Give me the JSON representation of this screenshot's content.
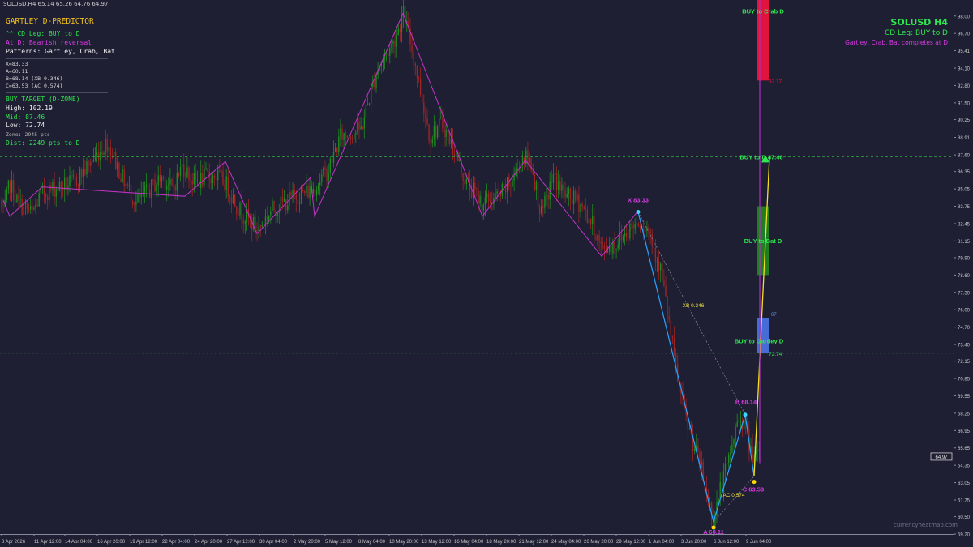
{
  "window": {
    "symbol_bar": "SOLUSD,H4  65.14 65.26 64.76 64.97"
  },
  "panel": {
    "title": "GARTLEY D-PREDICTOR",
    "cd_leg": "^^ CD Leg: BUY to D",
    "at_d": "At D: Bearish reversal",
    "patterns": "Patterns: Gartley, Crab, Bat",
    "x_line": "X=83.33",
    "a_line": "A=60.11",
    "b_line": "B=68.14  (XB 0.346)",
    "c_line": "C=63.53  (AC 0.574)",
    "buy_target_header": "BUY TARGET (D-ZONE)",
    "high_line": "High: 102.19",
    "mid_line": "Mid:  87.46",
    "low_line": "Low:  72.74",
    "zone_line": "Zone: 2945 pts",
    "dist_line": "Dist: 2249 pts to D"
  },
  "top_right": {
    "symbol": "SOLUSD H4",
    "cd_leg": "CD Leg: BUY to D",
    "completes": "Gartley, Crab, Bat completes at D"
  },
  "watermark": "currencyheatmap.com",
  "colors": {
    "background": "#1e1f33",
    "candle_up": "#1e8c1e",
    "candle_down": "#a02424",
    "zigzag": "#c633c8",
    "xabcd_leg": "#2aa4ff",
    "projection_leg": "#f5e020",
    "crab_zone": "#e0143c",
    "bat_zone": "#1f8f1f",
    "gartley_zone": "#4a70e0",
    "label_green": "#2ee84f",
    "label_magenta": "#d43be0",
    "label_yellow": "#f0e040"
  },
  "chart_data": {
    "type": "candlestick",
    "symbol": "SOLUSD",
    "timeframe": "H4",
    "ylim": [
      59.2,
      99.2
    ],
    "y_ticks": [
      "98.00",
      "96.70",
      "95.41",
      "94.10",
      "92.80",
      "91.50",
      "90.25",
      "88.91",
      "87.60",
      "86.35",
      "85.05",
      "83.75",
      "82.45",
      "81.15",
      "79.90",
      "78.60",
      "77.30",
      "76.00",
      "74.70",
      "73.40",
      "72.15",
      "70.85",
      "69.55",
      "68.25",
      "66.95",
      "65.65",
      "64.35",
      "63.05",
      "61.75",
      "60.50",
      "59.20"
    ],
    "current_price": "64.97",
    "x_ticks": [
      "8 Apr 2026",
      "11 Apr 12:00",
      "14 Apr 04:00",
      "16 Apr 20:00",
      "19 Apr 12:00",
      "22 Apr 04:00",
      "24 Apr 20:00",
      "27 Apr 12:00",
      "30 Apr 04:00",
      "2 May 20:00",
      "5 May 12:00",
      "8 May 04:00",
      "10 May 20:00",
      "13 May 12:00",
      "16 May 04:00",
      "18 May 20:00",
      "21 May 12:00",
      "24 May 04:00",
      "26 May 20:00",
      "29 May 12:00",
      "1 Jun 04:00",
      "3 Jun 20:00",
      "6 Jun 12:00",
      "9 Jun 04:00"
    ],
    "price_path": [
      [
        0,
        84.2
      ],
      [
        4,
        83.0
      ],
      [
        12,
        85.5
      ],
      [
        22,
        84.0
      ],
      [
        40,
        83.2
      ],
      [
        50,
        84.6
      ],
      [
        62,
        85.0
      ],
      [
        90,
        85.5
      ],
      [
        105,
        86.5
      ],
      [
        122,
        87.8
      ],
      [
        132,
        88.6
      ],
      [
        150,
        86.0
      ],
      [
        168,
        84.0
      ],
      [
        185,
        85.0
      ],
      [
        200,
        86.0
      ],
      [
        212,
        85.0
      ],
      [
        225,
        86.8
      ],
      [
        240,
        85.5
      ],
      [
        255,
        86.0
      ],
      [
        268,
        86.0
      ],
      [
        278,
        85.5
      ],
      [
        295,
        83.5
      ],
      [
        318,
        82.0
      ],
      [
        335,
        83.5
      ],
      [
        350,
        84.0
      ],
      [
        365,
        84.5
      ],
      [
        385,
        85.0
      ],
      [
        405,
        86.5
      ],
      [
        420,
        89.0
      ],
      [
        445,
        89.5
      ],
      [
        465,
        94.0
      ],
      [
        485,
        96.0
      ],
      [
        498,
        98.2
      ],
      [
        510,
        95.0
      ],
      [
        520,
        92.0
      ],
      [
        530,
        89.0
      ],
      [
        545,
        90.0
      ],
      [
        560,
        88.0
      ],
      [
        575,
        85.5
      ],
      [
        595,
        84.0
      ],
      [
        615,
        84.5
      ],
      [
        630,
        85.5
      ],
      [
        645,
        87.5
      ],
      [
        655,
        87.0
      ],
      [
        668,
        83.0
      ],
      [
        682,
        86.0
      ],
      [
        698,
        84.5
      ],
      [
        715,
        84.0
      ],
      [
        730,
        82.5
      ],
      [
        742,
        80.5
      ],
      [
        760,
        81.0
      ],
      [
        775,
        82.0
      ],
      [
        788,
        82.7
      ],
      [
        800,
        82.0
      ],
      [
        815,
        79.0
      ],
      [
        825,
        75.0
      ],
      [
        835,
        71.0
      ],
      [
        845,
        68.0
      ],
      [
        855,
        66.0
      ],
      [
        865,
        64.0
      ],
      [
        872,
        62.0
      ],
      [
        880,
        60.3
      ],
      [
        888,
        62.5
      ],
      [
        898,
        64.5
      ],
      [
        905,
        66.5
      ],
      [
        912,
        68.0
      ],
      [
        918,
        67.5
      ],
      [
        925,
        65.5
      ],
      [
        932,
        64.8
      ],
      [
        937,
        65.0
      ]
    ],
    "zigzag_points": [
      {
        "time": "8 Apr 2026",
        "price": 84.2
      },
      {
        "time": "9 Apr",
        "price": 83.0
      },
      {
        "time": "14 Apr",
        "price": 85.2
      },
      {
        "time": "24 Apr",
        "price": 84.5
      },
      {
        "time": "27 Apr 12:00",
        "price": 87.1
      },
      {
        "time": "28 Apr",
        "price": 81.7
      },
      {
        "time": "2 May",
        "price": 85.9
      },
      {
        "time": "3 May",
        "price": 83.0
      },
      {
        "time": "10 May 20:00",
        "price": 98.2
      },
      {
        "time": "18 May",
        "price": 83.0
      },
      {
        "time": "21 May 12:00",
        "price": 87.2
      },
      {
        "time": "28 May",
        "price": 80.0
      },
      {
        "time": "30 May",
        "price": 83.33
      }
    ],
    "xabcd": [
      {
        "label": "X",
        "price": 83.33,
        "text": "X 83.33"
      },
      {
        "label": "A",
        "price": 60.11,
        "text": "A 60.11"
      },
      {
        "label": "B",
        "price": 68.14,
        "text": "B 68.14"
      },
      {
        "label": "C",
        "price": 63.53,
        "text": "C 63.53"
      },
      {
        "label": "D",
        "price": 87.46,
        "text": "BUY to D 87.46"
      }
    ],
    "ratios": [
      {
        "label": "XB 0.346"
      },
      {
        "label": "AC 0.574"
      }
    ],
    "d_zones": [
      {
        "name": "BUY to Crab D",
        "low": 93.17,
        "high": 102.19,
        "right_label": "93.17"
      },
      {
        "name": "BUY to Bat D",
        "low": 78.6,
        "high": 83.75
      },
      {
        "name": "BUY to Gartley D",
        "low": 72.74,
        "high": 75.4,
        "right_label": "72.74",
        "edge_label": "07"
      }
    ],
    "mid_level": 87.46,
    "low_level": 72.74
  }
}
